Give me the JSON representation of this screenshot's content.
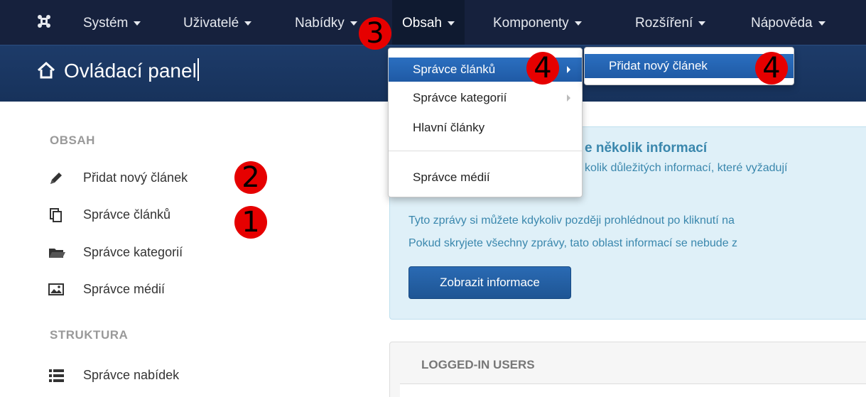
{
  "navbar": {
    "items": [
      {
        "label": "Systém"
      },
      {
        "label": "Uživatelé"
      },
      {
        "label": "Nabídky"
      },
      {
        "label": "Obsah"
      },
      {
        "label": "Komponenty"
      },
      {
        "label": "Rozšíření"
      },
      {
        "label": "Nápověda"
      }
    ]
  },
  "header": {
    "title": "Ovládací panel"
  },
  "sidebar": {
    "sections": [
      {
        "title": "OBSAH",
        "items": [
          {
            "label": "Přidat nový článek",
            "icon": "pencil-icon"
          },
          {
            "label": "Správce článků",
            "icon": "copy-icon"
          },
          {
            "label": "Správce kategorií",
            "icon": "folder-icon"
          },
          {
            "label": "Správce médií",
            "icon": "image-icon"
          }
        ]
      },
      {
        "title": "STRUKTURA",
        "items": [
          {
            "label": "Správce nabídek",
            "icon": "list-icon"
          }
        ]
      }
    ]
  },
  "content_menu": {
    "items": [
      {
        "label": "Správce článků"
      },
      {
        "label": "Správce kategorií"
      },
      {
        "label": "Hlavní články"
      },
      {
        "label": "Správce médií"
      }
    ],
    "submenu": {
      "label": "Přidat nový článek"
    }
  },
  "info": {
    "heading": "e několik informací",
    "subtext": "kolik důležitých informací, které vyžadují",
    "line1": "Tyto zprávy si můžete kdykoliv později prohlédnout po kliknutí na",
    "line2": "Pokud skryjete všechny zprávy, tato oblast informací se nebude z",
    "button": "Zobrazit informace"
  },
  "logged_in": {
    "title": "LOGGED-IN USERS"
  },
  "markers": [
    "1",
    "2",
    "3",
    "4",
    "4"
  ],
  "colors": {
    "navbar": "#16213d",
    "header": "#1d3b69",
    "accent": "#1f5aa5",
    "marker": "#e60000",
    "info_bg": "#dff0f8"
  }
}
